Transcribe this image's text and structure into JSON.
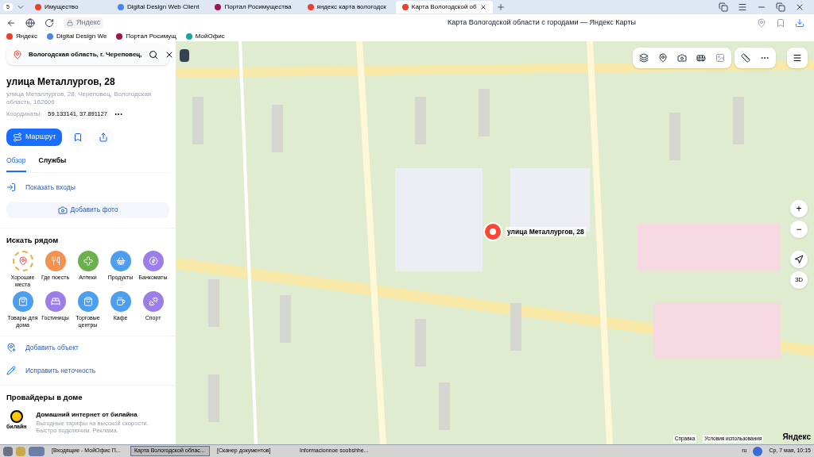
{
  "browser": {
    "tab_count": "5",
    "tabs": [
      {
        "label": "Имущество",
        "selected": false
      },
      {
        "label": "Digital Design Web Client",
        "selected": false
      },
      {
        "label": "Портал Росимущества",
        "selected": false
      },
      {
        "label": "яндекс карта вологодск",
        "selected": false
      },
      {
        "label": "Карта Вологодской об",
        "selected": true
      }
    ],
    "site": "Яндекс",
    "page_title": "Карта Вологодской области с городами — Яндекс Карты",
    "bookmarks": [
      "Яндекс",
      "Digital Design We",
      "Портал Росимущ",
      "МойОфис"
    ]
  },
  "panel": {
    "search": "Вологодская область, г. Череповец,",
    "title": "улица Металлургов, 28",
    "address": "улица Металлургов, 28, Череповец, Вологодская область, 162606",
    "coords_label": "Координаты:",
    "coords": "59.133141, 37.891127",
    "route": "Маршрут",
    "tabs": [
      {
        "label": "Обзор",
        "selected": true
      },
      {
        "label": "Службы",
        "selected": false
      }
    ],
    "show_entrances": "Показать входы",
    "add_photo": "Добавить фото",
    "nearby": {
      "title": "Искать рядом",
      "items": [
        {
          "label": "Хорошие места",
          "kind": "laurel",
          "color": "#e5b23a"
        },
        {
          "label": "Где поесть",
          "kind": "circle",
          "color": "#f39250"
        },
        {
          "label": "Аптеки",
          "kind": "circle",
          "color": "#6ab04c"
        },
        {
          "label": "Продукты",
          "kind": "circle",
          "color": "#4e9ef0"
        },
        {
          "label": "Банкоматы",
          "kind": "circle",
          "color": "#9b7ee8"
        },
        {
          "label": "Товары для дома",
          "kind": "circle",
          "color": "#4e9ef0"
        },
        {
          "label": "Гостиницы",
          "kind": "circle",
          "color": "#9b7ee8"
        },
        {
          "label": "Торговые центры",
          "kind": "circle",
          "color": "#4e9ef0"
        },
        {
          "label": "Кафе",
          "kind": "circle",
          "color": "#4e9ef0"
        },
        {
          "label": "Спорт",
          "kind": "circle",
          "color": "#9b7ee8"
        }
      ]
    },
    "actions": [
      "Добавить объект",
      "Исправить неточность"
    ],
    "providers": {
      "title": "Провайдеры в доме",
      "logo": "билайн",
      "name": "Домашний интернет от билайна",
      "description": "Выгодные тарифы на высокой скорости. Быстро подключим. Реклама."
    }
  },
  "map": {
    "pin_label": "улица Металлургов, 28",
    "zoom_in": "+",
    "zoom_out": "−",
    "mode_3d": "3D",
    "footer_links": [
      "Справка",
      "Условия использования"
    ],
    "logo": "Яндекс"
  },
  "taskbar": {
    "items": [
      {
        "label": "[Входящие - МойОфис П...",
        "selected": false
      },
      {
        "label": "Карта Вологодской облас...",
        "selected": true
      },
      {
        "label": "[Сканер документов]",
        "selected": false
      },
      {
        "label": "Informacionnoe soobshhe...",
        "selected": false
      }
    ],
    "lang": "ru",
    "clock": "Ср, 7 мая, 10:15"
  }
}
